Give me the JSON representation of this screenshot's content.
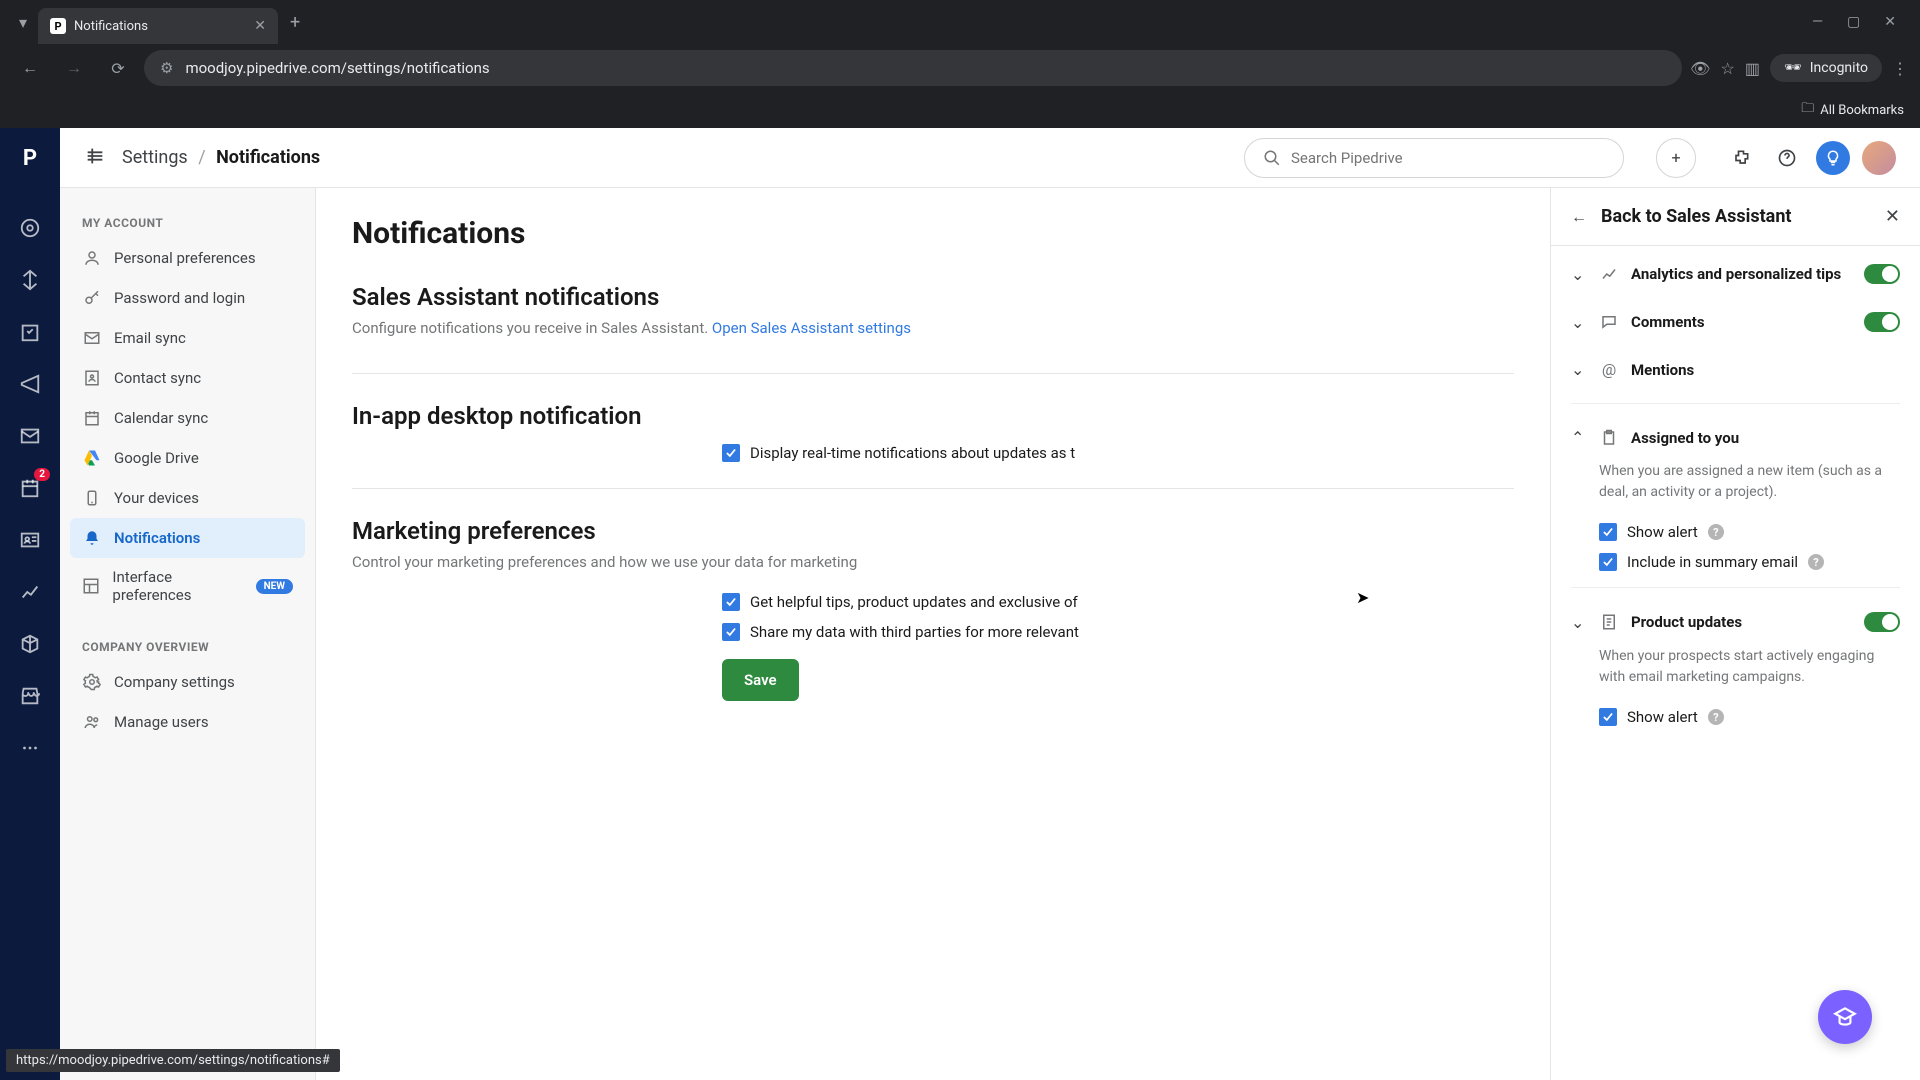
{
  "browser": {
    "tab_title": "Notifications",
    "url": "moodjoy.pipedrive.com/settings/notifications",
    "incognito_label": "Incognito",
    "bookmarks_label": "All Bookmarks",
    "status_url": "https://moodjoy.pipedrive.com/settings/notifications#"
  },
  "breadcrumb": {
    "parent": "Settings",
    "current": "Notifications"
  },
  "search": {
    "placeholder": "Search Pipedrive"
  },
  "rail_badge": "2",
  "sidebar": {
    "section1": "MY ACCOUNT",
    "items": [
      {
        "label": "Personal preferences"
      },
      {
        "label": "Password and login"
      },
      {
        "label": "Email sync"
      },
      {
        "label": "Contact sync"
      },
      {
        "label": "Calendar sync"
      },
      {
        "label": "Google Drive"
      },
      {
        "label": "Your devices"
      },
      {
        "label": "Notifications"
      },
      {
        "label": "Interface preferences",
        "new": "NEW"
      }
    ],
    "section2": "COMPANY OVERVIEW",
    "items2": [
      {
        "label": "Company settings"
      },
      {
        "label": "Manage users"
      }
    ]
  },
  "page": {
    "title": "Notifications",
    "s1_title": "Sales Assistant notifications",
    "s1_desc": "Configure notifications you receive in Sales Assistant. ",
    "s1_link": "Open Sales Assistant settings",
    "s2_title": "In-app desktop notification",
    "s2_check1": "Display real-time notifications about updates as t",
    "s3_title": "Marketing preferences",
    "s3_desc": "Control your marketing preferences and how we use your data for marketing",
    "s3_check1": "Get helpful tips, product updates and exclusive of",
    "s3_check2": "Share my data with third parties for more relevant",
    "save": "Save"
  },
  "panel": {
    "back": "Back to Sales Assistant",
    "rows": [
      {
        "label": "Analytics and personalized tips",
        "toggle": true,
        "expanded": false
      },
      {
        "label": "Comments",
        "toggle": true,
        "expanded": false
      },
      {
        "label": "Mentions",
        "toggle": false,
        "expanded": false
      },
      {
        "label": "Assigned to you",
        "toggle": false,
        "expanded": true,
        "desc": "When you are assigned a new item (such as a deal, an activity or a project).",
        "checks": [
          "Show alert",
          "Include in summary email"
        ]
      },
      {
        "label": "Product updates",
        "toggle": true,
        "expanded": false,
        "desc": "When your prospects start actively engaging with email marketing campaigns.",
        "checks": [
          "Show alert"
        ]
      }
    ]
  }
}
